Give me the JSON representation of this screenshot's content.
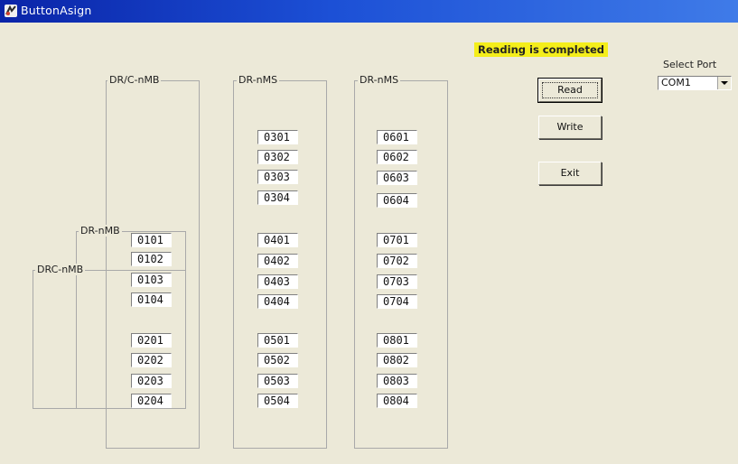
{
  "window": {
    "title": "ButtonAsign"
  },
  "status": {
    "message": "Reading is completed",
    "highlight_color": "#f4ee1b"
  },
  "port": {
    "label": "Select Port",
    "selected": "COM1"
  },
  "buttons": {
    "read": "Read",
    "write": "Write",
    "exit": "Exit"
  },
  "groups": {
    "drc_nmb": {
      "label": "DRC-nMB"
    },
    "dr_nmb": {
      "label": "DR-nMB"
    },
    "drc_nmb_outer": {
      "label": "DR/C-nMB"
    },
    "dr_nms_1": {
      "label": "DR-nMS"
    },
    "dr_nms_2": {
      "label": "DR-nMS"
    }
  },
  "fields": {
    "col1": [
      "0101",
      "0102",
      "0103",
      "0104",
      "0201",
      "0202",
      "0203",
      "0204"
    ],
    "col2": [
      "0301",
      "0302",
      "0303",
      "0304",
      "0401",
      "0402",
      "0403",
      "0404",
      "0501",
      "0502",
      "0503",
      "0504"
    ],
    "col3": [
      "0601",
      "0602",
      "0603",
      "0604",
      "0701",
      "0702",
      "0703",
      "0704",
      "0801",
      "0802",
      "0803",
      "0804"
    ]
  },
  "colors": {
    "titlebar": "#0a24a8",
    "face": "#ece9d8"
  }
}
